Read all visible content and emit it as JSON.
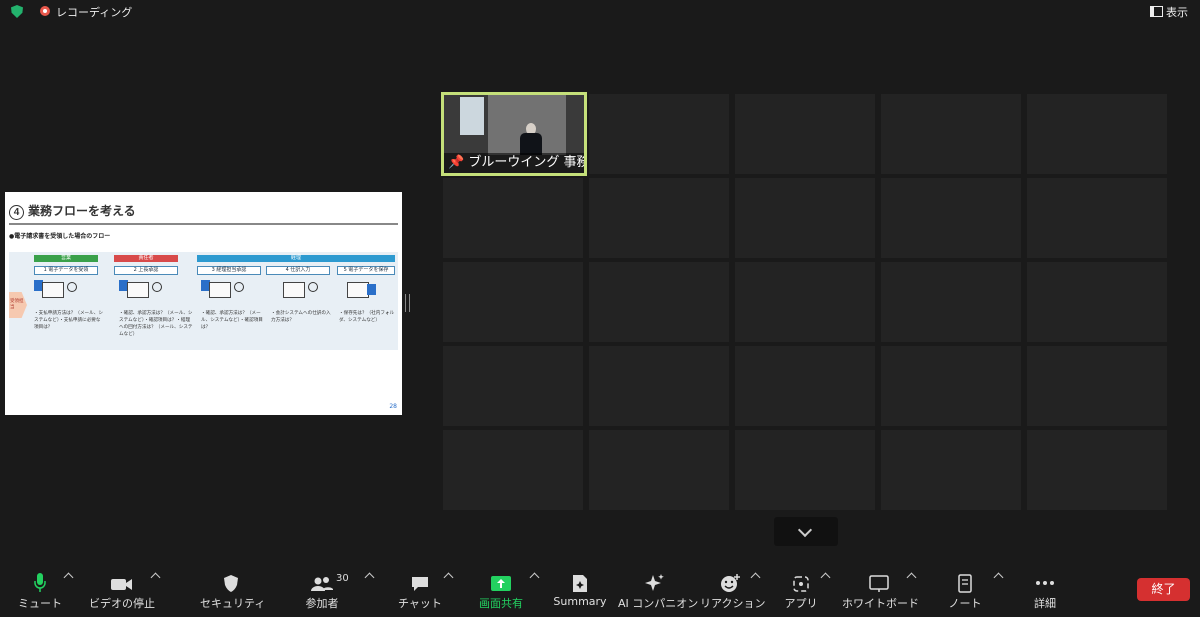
{
  "top_bar": {
    "recording_label": "レコーディング",
    "view_label": "表示"
  },
  "shared_screen": {
    "title_number": "4",
    "title": "業務フローを考える",
    "subtitle": "●電子請求書を受領した場合のフロー",
    "stages": [
      "営業",
      "責任者",
      "経理"
    ],
    "steps": [
      "1 電子データを受領",
      "2 上長承認",
      "3 経理担当承認",
      "4 仕訳入力",
      "5 電子データを保存"
    ],
    "side_tag": "受領担当",
    "notes": [
      "・支払申請方法は？（メール、システムなど）・支払申請に必要な項目は？",
      "・確認、承認方法は？（メール、システムなど）・確認項目は？・経理への回付方法は？（メール、システムなど）",
      "・確認、承認方法は？（メール、システムなど）・確認項目は？",
      "・会計システムへの仕訳の入力方法は？",
      "・保存先は？（社内フォルダ、システムなど）"
    ],
    "page_number": "28"
  },
  "participant": {
    "name": "ブルーウイング 事務..."
  },
  "toolbar": {
    "mute": "ミュート",
    "video": "ビデオの停止",
    "security": "セキュリティ",
    "participants": "参加者",
    "participants_count": "30",
    "chat": "チャット",
    "share": "画面共有",
    "summary": "Summary",
    "ai": "AI コンパニオン",
    "reactions": "リアクション",
    "apps": "アプリ",
    "whiteboard": "ホワイトボード",
    "notes": "ノート",
    "more": "詳細",
    "end": "終了"
  },
  "colors": {
    "share_green": "#23d160",
    "end_red": "#d53030",
    "active_border": "#c5e07a"
  }
}
